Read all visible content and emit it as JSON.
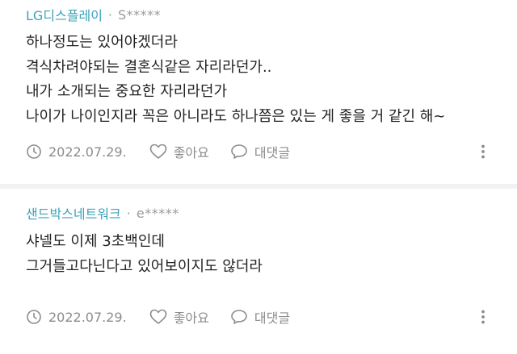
{
  "comments": [
    {
      "company": "LG디스플레이",
      "user": "S*****",
      "lines": [
        "하나정도는 있어야겠더라",
        "격식차려야되는 결혼식같은 자리라던가..",
        "내가 소개되는 중요한 자리라던가",
        "나이가 나이인지라 꼭은 아니라도 하나쯤은 있는 게 좋을 거 같긴 해~"
      ],
      "date": "2022.07.29.",
      "like_label": "좋아요",
      "reply_label": "대댓글"
    },
    {
      "company": "샌드박스네트워크",
      "user": "e*****",
      "lines": [
        "샤넬도 이제 3초백인데",
        "그거들고다닌다고 있어보이지도 않더라"
      ],
      "date": "2022.07.29.",
      "like_label": "좋아요",
      "reply_label": "대댓글"
    }
  ],
  "separator": "·",
  "icons": {
    "date": "clock-icon",
    "like": "heart-icon",
    "reply": "speech-bubble-icon",
    "more": "more-dots-icon"
  },
  "colors": {
    "company": "#3aa3b8",
    "meta": "#8c8c8c",
    "divider": "#f2f2f4",
    "text": "#222222"
  }
}
